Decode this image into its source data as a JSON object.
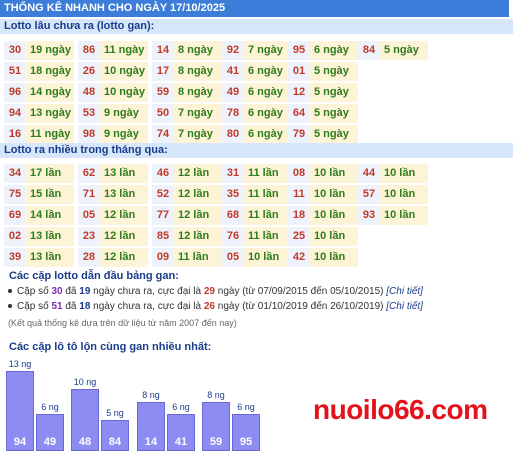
{
  "header_title": "THỐNG KÊ NHANH CHO NGÀY 17/10/2025",
  "section1_title": "Lotto lâu chưa ra (lotto gan):",
  "gan": [
    {
      "n": "30",
      "v": "19 ngày"
    },
    {
      "n": "86",
      "v": "11 ngày"
    },
    {
      "n": "14",
      "v": "8 ngày"
    },
    {
      "n": "92",
      "v": "7 ngày"
    },
    {
      "n": "95",
      "v": "6 ngày"
    },
    {
      "n": "84",
      "v": "5 ngày"
    },
    {
      "n": "51",
      "v": "18 ngày"
    },
    {
      "n": "26",
      "v": "10 ngày"
    },
    {
      "n": "17",
      "v": "8 ngày"
    },
    {
      "n": "41",
      "v": "6 ngày"
    },
    {
      "n": "01",
      "v": "5 ngày"
    },
    {
      "n": "96",
      "v": "14 ngày"
    },
    {
      "n": "48",
      "v": "10 ngày"
    },
    {
      "n": "59",
      "v": "8 ngày"
    },
    {
      "n": "49",
      "v": "6 ngày"
    },
    {
      "n": "12",
      "v": "5 ngày"
    },
    {
      "n": "94",
      "v": "13 ngày"
    },
    {
      "n": "53",
      "v": "9 ngày"
    },
    {
      "n": "50",
      "v": "7 ngày"
    },
    {
      "n": "78",
      "v": "6 ngày"
    },
    {
      "n": "64",
      "v": "5 ngày"
    },
    {
      "n": "16",
      "v": "11 ngày"
    },
    {
      "n": "98",
      "v": "9 ngày"
    },
    {
      "n": "74",
      "v": "7 ngày"
    },
    {
      "n": "80",
      "v": "6 ngày"
    },
    {
      "n": "79",
      "v": "5 ngày"
    }
  ],
  "section2_title": "Lotto ra nhiều trong tháng qua:",
  "nhieu": [
    {
      "n": "34",
      "v": "17 lần"
    },
    {
      "n": "62",
      "v": "13 lần"
    },
    {
      "n": "46",
      "v": "12 lần"
    },
    {
      "n": "31",
      "v": "11 lần"
    },
    {
      "n": "08",
      "v": "10 lần"
    },
    {
      "n": "44",
      "v": "10 lần"
    },
    {
      "n": "75",
      "v": "15 lần"
    },
    {
      "n": "71",
      "v": "13 lần"
    },
    {
      "n": "52",
      "v": "12 lần"
    },
    {
      "n": "35",
      "v": "11 lần"
    },
    {
      "n": "11",
      "v": "10 lần"
    },
    {
      "n": "57",
      "v": "10 lần"
    },
    {
      "n": "69",
      "v": "14 lần"
    },
    {
      "n": "05",
      "v": "12 lần"
    },
    {
      "n": "77",
      "v": "12 lần"
    },
    {
      "n": "68",
      "v": "11 lần"
    },
    {
      "n": "18",
      "v": "10 lần"
    },
    {
      "n": "93",
      "v": "10 lần"
    },
    {
      "n": "02",
      "v": "13 lần"
    },
    {
      "n": "23",
      "v": "12 lần"
    },
    {
      "n": "85",
      "v": "12 lần"
    },
    {
      "n": "76",
      "v": "11 lần"
    },
    {
      "n": "25",
      "v": "10 lần"
    },
    {
      "n": "39",
      "v": "13 lần"
    },
    {
      "n": "28",
      "v": "12 lần"
    },
    {
      "n": "09",
      "v": "11 lần"
    },
    {
      "n": "05",
      "v": "10 lần"
    },
    {
      "n": "42",
      "v": "10 lần"
    }
  ],
  "pairs_title": "Các cặp lotto dẫn đầu bảng gan:",
  "pairs": [
    {
      "t1": "Cặp số ",
      "pair": "30",
      "t2": " đã ",
      "days": "19",
      "t3": " ngày chưa ra, cực đại là ",
      "max": "29",
      "t4": " ngày (từ 07/09/2015 đến 05/10/2015) ",
      "link": "[Chi tiết]"
    },
    {
      "t1": "Cặp số ",
      "pair": "51",
      "t2": " đã ",
      "days": "18",
      "t3": " ngày chưa ra, cực đại là ",
      "max": "26",
      "t4": " ngày (từ 01/10/2019 đến 26/10/2019) ",
      "link": "[Chi tiết]"
    }
  ],
  "pairs_note": "(Kết quả thống kê dựa trên dữ liệu từ năm 2007 đến nay)",
  "chart_title": "Các cặp lô tô lộn cùng gan nhiều nhất:",
  "chart_data": {
    "type": "bar",
    "categories": [
      "94",
      "49",
      "48",
      "84",
      "14",
      "41",
      "59",
      "95"
    ],
    "values": [
      13,
      6,
      10,
      5,
      8,
      6,
      8,
      6
    ],
    "labels": [
      "13 ng",
      "6 ng",
      "10 ng",
      "5 ng",
      "8 ng",
      "6 ng",
      "8 ng",
      "6 ng"
    ]
  },
  "brand": "nuoilo66.com",
  "colors": {
    "header": "#3b7dd8",
    "section": "#d7e7fb",
    "number": "#c0392b",
    "value": "#2e7d1a",
    "bar": "#8c8cf2",
    "brand": "#e3121b"
  }
}
